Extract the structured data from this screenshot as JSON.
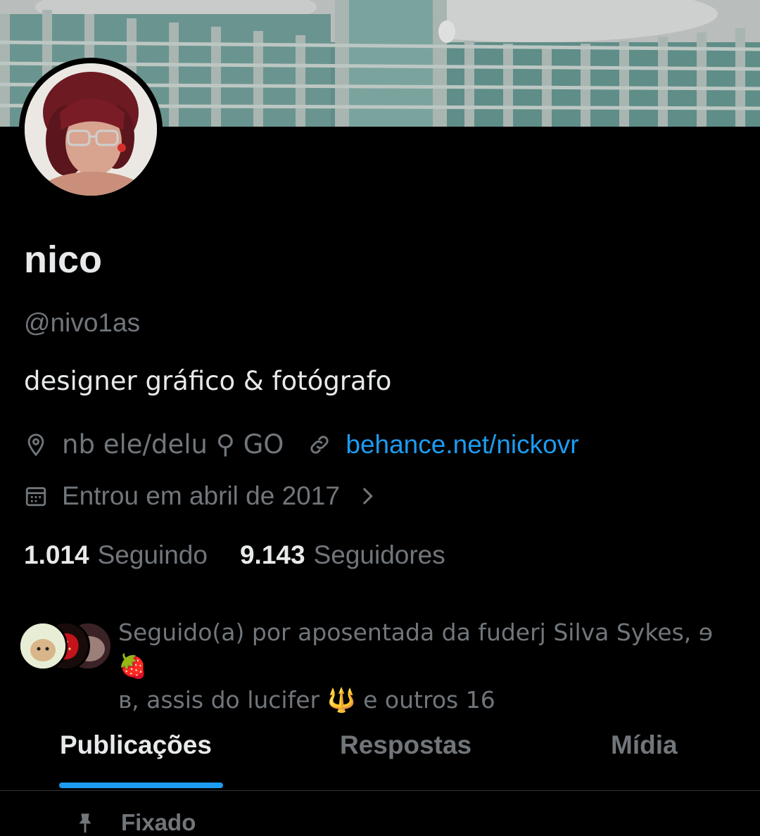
{
  "profile": {
    "name": "nico",
    "handle": "@nivo1as",
    "bio": "designer gráfico & fotógrafo",
    "location": "nb ele/delu ⚲ GO",
    "website": "behance.net/nickovr",
    "joined": "Entrou em abril de 2017"
  },
  "stats": {
    "following_count": "1.014",
    "following_label": "Seguindo",
    "followers_count": "9.143",
    "followers_label": "Seguidores"
  },
  "followed_by": {
    "line1": "Seguido(a) por aposentada da fuderj Silva Sykes, ɘ🍓",
    "line2": "ʙ, assis do lucifer 🔱 e outros 16"
  },
  "tabs": [
    {
      "label": "Publicações",
      "active": true
    },
    {
      "label": "Respostas",
      "active": false
    },
    {
      "label": "Mídia",
      "active": false
    }
  ],
  "pinned": {
    "label": "Fixado"
  },
  "icons": {
    "location": "location-pin-icon",
    "link": "link-icon",
    "calendar": "calendar-icon",
    "chevron": "chevron-right-icon",
    "pin": "pin-icon"
  },
  "colors": {
    "accent": "#1d9bf0",
    "muted": "#71767b",
    "text": "#e7e9ea"
  }
}
